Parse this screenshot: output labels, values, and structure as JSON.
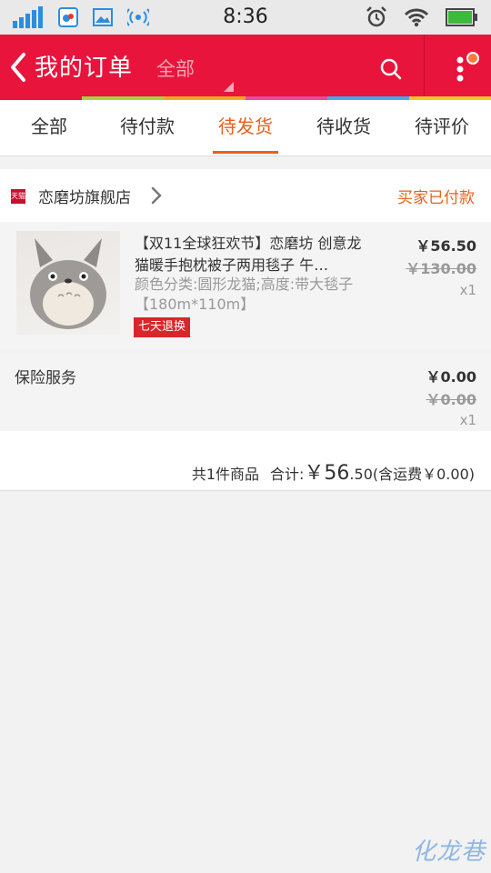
{
  "statusbar": {
    "time": "8:36"
  },
  "header": {
    "title": "我的订单",
    "filter": "全部"
  },
  "tabs": [
    "全部",
    "待付款",
    "待发货",
    "待收货",
    "待评价"
  ],
  "active_tab": "待发货",
  "order": {
    "store_badge": "天猫",
    "store_name": "恋磨坊旗舰店",
    "status": "买家已付款",
    "item": {
      "title": "【双11全球狂欢节】恋磨坊 创意龙猫暖手抱枕被子两用毯子 午…",
      "spec": "颜色分类:圆形龙猫;高度:带大毯子【180m*110m】",
      "tag": "七天退换",
      "price": "￥56.50",
      "original_price": "￥130.00",
      "quantity": "x1"
    },
    "insurance": {
      "label": "保险服务",
      "price": "￥0.00",
      "original_price": "￥0.00",
      "quantity": "x1"
    },
    "summary": {
      "count_text": "共1件商品",
      "total_label": "合计: ",
      "currency": "￥",
      "total_int": "56",
      "total_dec": ".50",
      "shipping": " (含运费￥0.00)"
    }
  },
  "watermark": "化龙巷",
  "colors": {
    "header": "#e8143c",
    "accent": "#e8601d",
    "tag": "#d9262b"
  }
}
